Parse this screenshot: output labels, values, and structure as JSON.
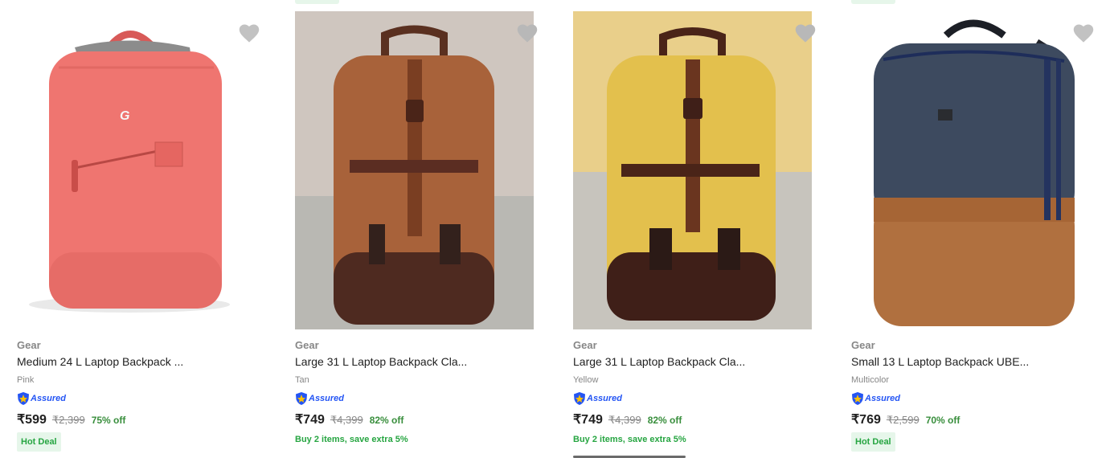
{
  "products": [
    {
      "brand": "Gear",
      "title": "Medium 24 L Laptop Backpack ...",
      "color": "Pink",
      "assured": "Assured",
      "price": "₹599",
      "mrp": "₹2,399",
      "discount": "75% off",
      "deal": "Hot Deal",
      "offer": ""
    },
    {
      "brand": "Gear",
      "title": "Large 31 L Laptop Backpack Cla...",
      "color": "Tan",
      "assured": "Assured",
      "price": "₹749",
      "mrp": "₹4,399",
      "discount": "82% off",
      "deal": "",
      "offer": "Buy 2 items, save extra 5%"
    },
    {
      "brand": "Gear",
      "title": "Large 31 L Laptop Backpack Cla...",
      "color": "Yellow",
      "assured": "Assured",
      "price": "₹749",
      "mrp": "₹4,399",
      "discount": "82% off",
      "deal": "",
      "offer": "Buy 2 items, save extra 5%"
    },
    {
      "brand": "Gear",
      "title": "Small 13 L Laptop Backpack UBE...",
      "color": "Multicolor",
      "assured": "Assured",
      "price": "₹769",
      "mrp": "₹2,599",
      "discount": "70% off",
      "deal": "Hot Deal",
      "offer": ""
    }
  ],
  "icons": {
    "wishlist": "heart-icon",
    "assured": "shield-icon"
  },
  "colors": {
    "discount": "#388e3c",
    "deal_bg": "#e6f6ea",
    "assured": "#2455f4",
    "wishlist": "#c2c2c2"
  }
}
